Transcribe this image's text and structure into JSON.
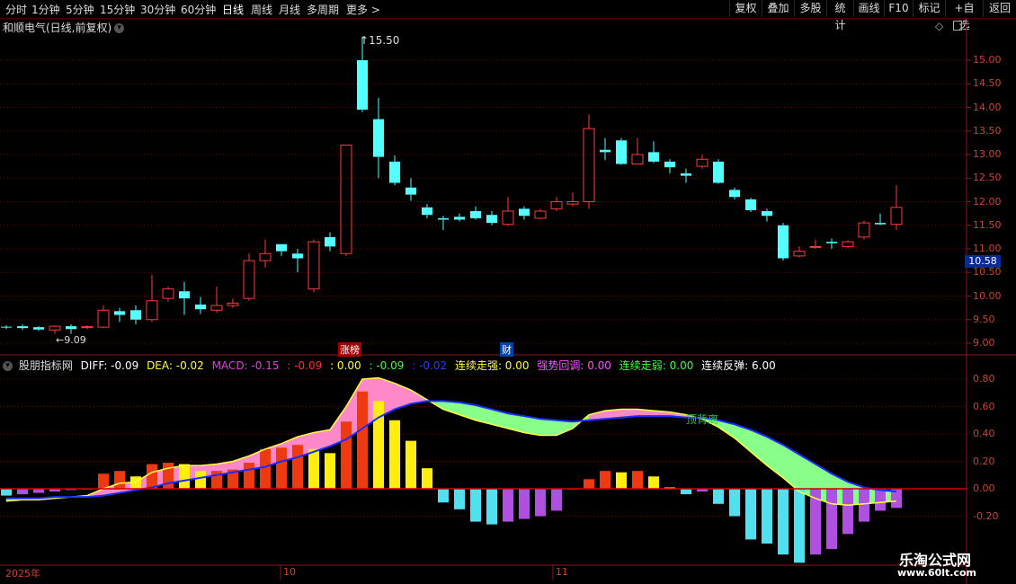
{
  "toolbar": {
    "tabs": [
      "分时",
      "1分钟",
      "5分钟",
      "15分钟",
      "30分钟",
      "60分钟",
      "日线",
      "周线",
      "月线",
      "多周期",
      "更多 >"
    ],
    "active_tab": "日线",
    "right_buttons": [
      "复权",
      "叠加",
      "多股",
      "统计",
      "画线",
      "F10",
      "标记",
      "+自选",
      "返回"
    ]
  },
  "chart_title": "和顺电气(日线,前复权)",
  "price_axis": [
    "15.00",
    "14.50",
    "14.00",
    "13.50",
    "13.00",
    "12.50",
    "12.00",
    "11.50",
    "11.00",
    "10.50",
    "10.00",
    "9.50",
    "9.00"
  ],
  "current_price": "10.58",
  "max_price_label": "15.50",
  "min_price_label": "9.09",
  "event_tags": {
    "limit": "涨榜",
    "finance": "财"
  },
  "indicator_line": {
    "name": "股朋指标网",
    "diff": "DIFF: -0.09",
    "dea": "DEA: -0.02",
    "macd": "MACD: -0.15",
    "v1": ": -0.09",
    "v2": ": 0.00",
    "v3": ": -0.09",
    "v4": ": -0.02",
    "lxzq": "连续走强: 0.00",
    "qshd": "强势回调: 0.00",
    "lxzr": "连续走弱: 0.00",
    "lxft": "连续反弹: 6.00"
  },
  "indicator_axis": [
    "0.80",
    "0.60",
    "0.40",
    "0.20",
    "0.00",
    "-0.20"
  ],
  "indicator_annotation": "顶背离",
  "date_axis": [
    "2025年",
    "10",
    "11"
  ],
  "watermark": {
    "line1": "乐淘公式网",
    "line2": "www.60lt.com"
  },
  "colors": {
    "up": "#ff3b3b",
    "down": "#54ffff",
    "dea": "#1a2cff",
    "diff": "#ffff40"
  },
  "chart_data": {
    "type": "candlestick",
    "candles": [
      [
        9.35,
        9.34,
        9.38,
        9.3
      ],
      [
        9.36,
        9.32,
        9.4,
        9.28
      ],
      [
        9.34,
        9.29,
        9.36,
        9.26
      ],
      [
        9.28,
        9.36,
        9.38,
        9.2
      ],
      [
        9.36,
        9.3,
        9.4,
        9.2
      ],
      [
        9.33,
        9.35,
        9.38,
        9.3
      ],
      [
        9.34,
        9.7,
        9.8,
        9.32
      ],
      [
        9.68,
        9.6,
        9.75,
        9.45
      ],
      [
        9.7,
        9.5,
        9.8,
        9.4
      ],
      [
        9.5,
        9.9,
        10.45,
        9.45
      ],
      [
        9.95,
        10.15,
        10.2,
        9.88
      ],
      [
        10.1,
        9.95,
        10.3,
        9.6
      ],
      [
        9.82,
        9.72,
        9.98,
        9.62
      ],
      [
        9.7,
        9.8,
        10.2,
        9.65
      ],
      [
        9.8,
        9.85,
        9.95,
        9.75
      ],
      [
        9.95,
        10.75,
        10.9,
        9.9
      ],
      [
        10.75,
        10.9,
        11.2,
        10.6
      ],
      [
        11.1,
        10.95,
        11.1,
        10.85
      ],
      [
        10.9,
        10.8,
        11.0,
        10.5
      ],
      [
        10.15,
        11.15,
        11.2,
        10.08
      ],
      [
        11.25,
        11.05,
        11.35,
        10.95
      ],
      [
        10.9,
        13.2,
        13.2,
        10.85
      ],
      [
        15.0,
        13.95,
        15.5,
        13.9
      ],
      [
        13.75,
        12.95,
        14.2,
        12.5
      ],
      [
        12.85,
        12.4,
        12.98,
        12.35
      ],
      [
        12.3,
        12.15,
        12.5,
        12.02
      ],
      [
        11.88,
        11.72,
        11.95,
        11.65
      ],
      [
        11.65,
        11.62,
        11.7,
        11.4
      ],
      [
        11.68,
        11.62,
        11.75,
        11.58
      ],
      [
        11.8,
        11.65,
        11.9,
        11.62
      ],
      [
        11.72,
        11.55,
        11.8,
        11.5
      ],
      [
        11.52,
        11.8,
        12.1,
        11.48
      ],
      [
        11.85,
        11.7,
        11.9,
        11.62
      ],
      [
        11.65,
        11.8,
        11.85,
        11.63
      ],
      [
        11.85,
        12.0,
        12.1,
        11.8
      ],
      [
        11.95,
        12.0,
        12.2,
        11.9
      ],
      [
        12.0,
        13.55,
        13.85,
        11.85
      ],
      [
        13.1,
        13.05,
        13.35,
        12.88
      ],
      [
        13.3,
        12.8,
        13.35,
        12.78
      ],
      [
        12.8,
        13.0,
        13.35,
        12.8
      ],
      [
        13.05,
        12.85,
        13.28,
        12.82
      ],
      [
        12.85,
        12.73,
        12.9,
        12.6
      ],
      [
        12.6,
        12.55,
        12.7,
        12.4
      ],
      [
        12.75,
        12.9,
        13.0,
        12.7
      ],
      [
        12.85,
        12.4,
        12.9,
        12.38
      ],
      [
        12.25,
        12.1,
        12.3,
        12.05
      ],
      [
        12.05,
        11.82,
        12.08,
        11.78
      ],
      [
        11.8,
        11.7,
        11.85,
        11.58
      ],
      [
        11.5,
        10.8,
        11.55,
        10.75
      ],
      [
        10.85,
        10.95,
        11.05,
        10.82
      ],
      [
        11.05,
        11.05,
        11.2,
        11.0
      ],
      [
        11.15,
        11.12,
        11.22,
        11.0
      ],
      [
        11.05,
        11.15,
        11.18,
        11.02
      ],
      [
        11.25,
        11.55,
        11.6,
        11.2
      ],
      [
        11.55,
        11.52,
        11.75,
        11.5
      ],
      [
        11.52,
        11.88,
        12.35,
        11.4
      ]
    ],
    "macd_values": [
      -0.05,
      -0.04,
      -0.03,
      -0.02,
      -0.01,
      0.0,
      0.11,
      0.13,
      0.09,
      0.18,
      0.19,
      0.18,
      0.13,
      0.13,
      0.14,
      0.19,
      0.29,
      0.3,
      0.32,
      0.29,
      0.26,
      0.49,
      0.71,
      0.64,
      0.5,
      0.35,
      0.15,
      -0.1,
      -0.15,
      -0.24,
      -0.26,
      -0.24,
      -0.22,
      -0.2,
      -0.16,
      0.0,
      0.07,
      0.13,
      0.12,
      0.13,
      0.09,
      0.01,
      -0.04,
      -0.02,
      -0.11,
      -0.2,
      -0.37,
      -0.4,
      -0.48,
      -0.54,
      -0.48,
      -0.44,
      -0.33,
      -0.24,
      -0.16,
      -0.14
    ],
    "dea_values": [
      -0.07,
      -0.07,
      -0.07,
      -0.06,
      -0.06,
      -0.06,
      -0.05,
      -0.03,
      -0.01,
      0.01,
      0.04,
      0.06,
      0.08,
      0.1,
      0.12,
      0.14,
      0.16,
      0.2,
      0.23,
      0.27,
      0.31,
      0.36,
      0.44,
      0.52,
      0.58,
      0.62,
      0.64,
      0.64,
      0.63,
      0.61,
      0.58,
      0.55,
      0.53,
      0.51,
      0.5,
      0.49,
      0.5,
      0.51,
      0.52,
      0.53,
      0.53,
      0.53,
      0.52,
      0.52,
      0.5,
      0.47,
      0.43,
      0.38,
      0.32,
      0.25,
      0.18,
      0.11,
      0.05,
      0.01,
      -0.01,
      -0.02
    ],
    "diff_values": [
      -0.09,
      -0.08,
      -0.08,
      -0.07,
      -0.06,
      -0.05,
      0.0,
      0.04,
      0.05,
      0.12,
      0.15,
      0.17,
      0.17,
      0.18,
      0.2,
      0.24,
      0.29,
      0.33,
      0.38,
      0.41,
      0.43,
      0.6,
      0.8,
      0.81,
      0.77,
      0.72,
      0.65,
      0.58,
      0.54,
      0.5,
      0.47,
      0.44,
      0.41,
      0.39,
      0.39,
      0.44,
      0.54,
      0.57,
      0.58,
      0.58,
      0.57,
      0.56,
      0.54,
      0.51,
      0.45,
      0.37,
      0.27,
      0.17,
      0.08,
      -0.02,
      -0.07,
      -0.11,
      -0.12,
      -0.11,
      -0.1,
      -0.09
    ],
    "price_range": [
      8.75,
      15.9
    ],
    "indicator_range": [
      -0.55,
      0.9
    ]
  }
}
